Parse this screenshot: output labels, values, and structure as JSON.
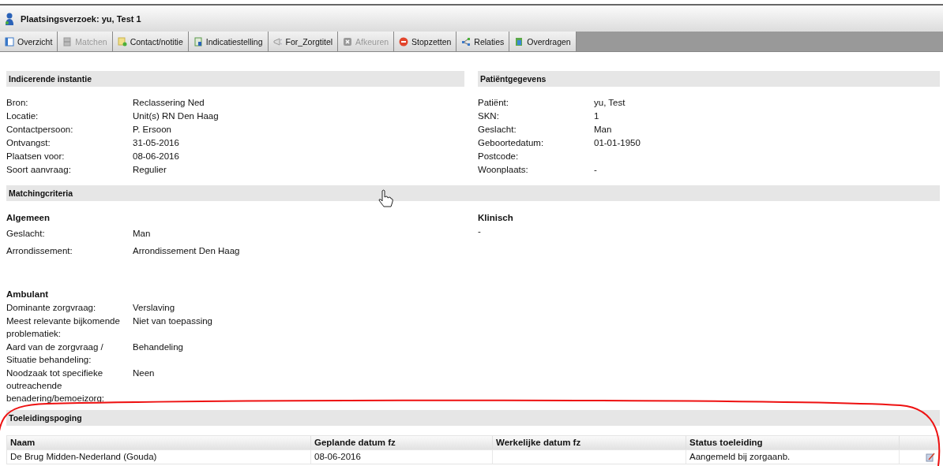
{
  "title_bar": {
    "title": "Plaatsingsverzoek:  yu, Test  1"
  },
  "tabs": [
    {
      "label": "Overzicht",
      "kind": "panel",
      "disabled": false
    },
    {
      "label": "Matchen",
      "kind": "cabinet",
      "disabled": true
    },
    {
      "label": "Contact/notitie",
      "kind": "note",
      "disabled": false
    },
    {
      "label": "Indicatiestelling",
      "kind": "document",
      "disabled": false
    },
    {
      "label": "For_Zorgtitel",
      "kind": "megaphone",
      "disabled": false
    },
    {
      "label": "Afkeuren",
      "kind": "cross",
      "disabled": true
    },
    {
      "label": "Stopzetten",
      "kind": "stop",
      "disabled": false
    },
    {
      "label": "Relaties",
      "kind": "network",
      "disabled": false
    },
    {
      "label": "Overdragen",
      "kind": "transfer",
      "disabled": false
    }
  ],
  "indicerende_instantie": {
    "heading": "Indicerende instantie",
    "rows": [
      {
        "label": "Bron:",
        "value": "Reclassering Ned"
      },
      {
        "label": "Locatie:",
        "value": "Unit(s) RN Den Haag"
      },
      {
        "label": "Contactpersoon:",
        "value": "P. Ersoon"
      },
      {
        "label": "Ontvangst:",
        "value": "31-05-2016"
      },
      {
        "label": "Plaatsen voor:",
        "value": "08-06-2016"
      },
      {
        "label": "Soort aanvraag:",
        "value": "Regulier"
      }
    ]
  },
  "patientgegevens": {
    "heading": "Patiëntgegevens",
    "rows": [
      {
        "label": "Patiënt:",
        "value": "yu, Test"
      },
      {
        "label": "SKN:",
        "value": "1"
      },
      {
        "label": "Geslacht:",
        "value": "Man"
      },
      {
        "label": "Geboortedatum:",
        "value": "01-01-1950"
      },
      {
        "label": "Postcode:"
      },
      {
        "label": "Woonplaats:",
        "value": "-"
      }
    ]
  },
  "matchingcriteria": {
    "heading": "Matchingcriteria",
    "algemeen": {
      "heading": "Algemeen",
      "rows": [
        {
          "label": "Geslacht:",
          "value": "Man"
        },
        {
          "label": "Arrondissement:",
          "value": "Arrondissement Den Haag"
        }
      ]
    },
    "klinisch": {
      "heading": "Klinisch",
      "text": "-"
    },
    "ambulant": {
      "heading": "Ambulant",
      "rows": [
        {
          "label": "Dominante zorgvraag:",
          "value": "Verslaving"
        },
        {
          "label": "Meest relevante bijkomende problematiek:",
          "value": "Niet van toepassing"
        },
        {
          "label": "Aard van de zorgvraag / Situatie behandeling:",
          "value": "Behandeling"
        },
        {
          "label": "Noodzaak tot specifieke outreachende benadering/bemoeizorg:",
          "value": "Neen"
        }
      ]
    }
  },
  "toeleidingspoging": {
    "heading": "Toeleidingspoging",
    "columns": [
      "Naam",
      "Geplande datum fz",
      "Werkelijke datum fz",
      "Status toeleiding"
    ],
    "rows": [
      {
        "cells": [
          "De Brug Midden-Nederland (Gouda)",
          "08-06-2016",
          "",
          "Aangemeld bij zorgaanb."
        ],
        "editable": true
      }
    ]
  }
}
